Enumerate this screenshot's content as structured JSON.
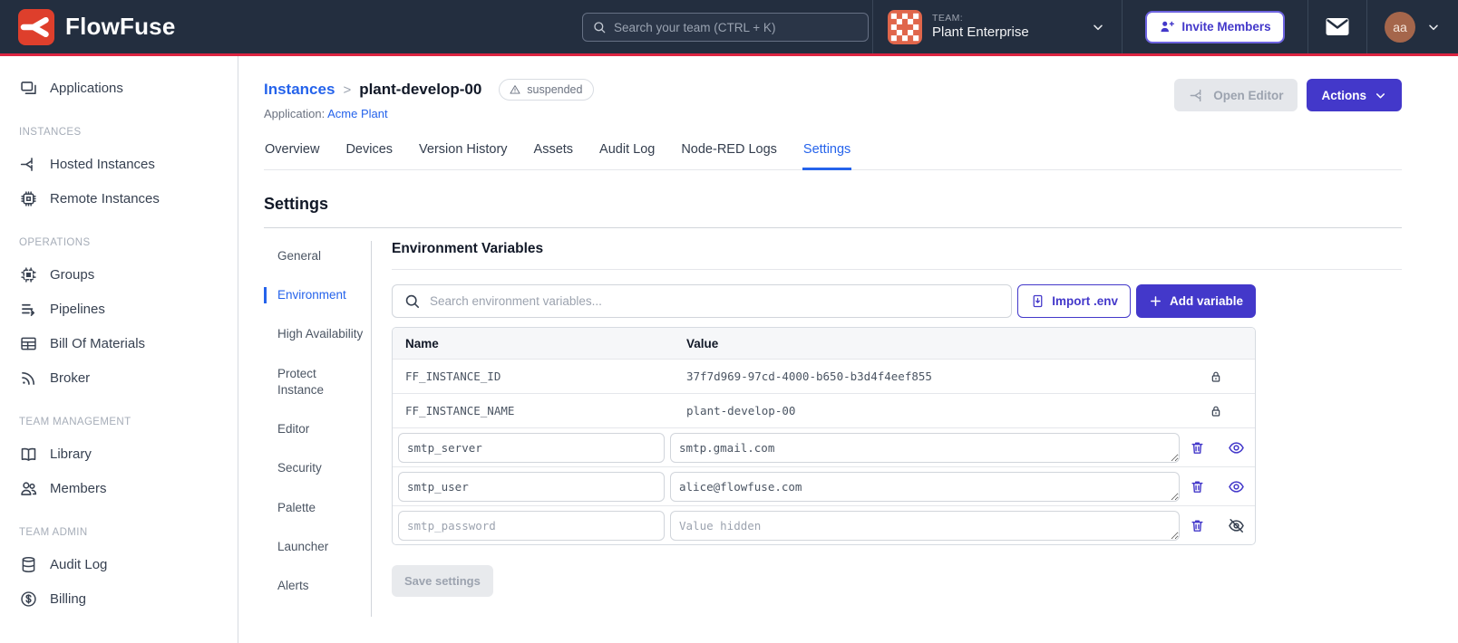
{
  "colors": {
    "navbar_bg": "#232E3F",
    "brand_red": "#DC2440",
    "accent_indigo": "#4338CA",
    "link_blue": "#2563EB",
    "team_avatar_orange": "#E0664B",
    "user_avatar_brown": "#A5664B"
  },
  "navbar": {
    "brand": "FlowFuse",
    "search_placeholder": "Search your team (CTRL + K)",
    "team_label": "TEAM:",
    "team_name": "Plant Enterprise",
    "invite_button": "Invite Members",
    "user_initials": "aa"
  },
  "sidebar": {
    "top_items": [
      {
        "label": "Applications",
        "icon": "applications-icon"
      }
    ],
    "sections": [
      {
        "title": "INSTANCES",
        "items": [
          {
            "label": "Hosted Instances",
            "icon": "hosted-instances-icon"
          },
          {
            "label": "Remote Instances",
            "icon": "remote-instances-icon"
          }
        ]
      },
      {
        "title": "OPERATIONS",
        "items": [
          {
            "label": "Groups",
            "icon": "groups-icon"
          },
          {
            "label": "Pipelines",
            "icon": "pipelines-icon"
          },
          {
            "label": "Bill Of Materials",
            "icon": "bill-of-materials-icon"
          },
          {
            "label": "Broker",
            "icon": "broker-icon"
          }
        ]
      },
      {
        "title": "TEAM MANAGEMENT",
        "items": [
          {
            "label": "Library",
            "icon": "library-icon"
          },
          {
            "label": "Members",
            "icon": "members-icon"
          }
        ]
      },
      {
        "title": "TEAM ADMIN",
        "items": [
          {
            "label": "Audit Log",
            "icon": "audit-log-icon"
          },
          {
            "label": "Billing",
            "icon": "billing-icon"
          }
        ]
      }
    ]
  },
  "header": {
    "breadcrumb_root": "Instances",
    "separator": ">",
    "instance_name": "plant-develop-00",
    "status_badge": "suspended",
    "application_label": "Application:",
    "application_name": "Acme Plant",
    "open_editor_button": "Open Editor",
    "actions_button": "Actions"
  },
  "tabs": [
    {
      "label": "Overview"
    },
    {
      "label": "Devices"
    },
    {
      "label": "Version History"
    },
    {
      "label": "Assets"
    },
    {
      "label": "Audit Log"
    },
    {
      "label": "Node-RED Logs"
    },
    {
      "label": "Settings",
      "active": true
    }
  ],
  "settings": {
    "title": "Settings",
    "nav": [
      {
        "label": "General"
      },
      {
        "label": "Environment",
        "active": true
      },
      {
        "label": "High Availability"
      },
      {
        "label": "Protect Instance"
      },
      {
        "label": "Editor"
      },
      {
        "label": "Security"
      },
      {
        "label": "Palette"
      },
      {
        "label": "Launcher"
      },
      {
        "label": "Alerts"
      }
    ],
    "environment": {
      "title": "Environment Variables",
      "search_placeholder": "Search environment variables...",
      "import_button": "Import .env",
      "add_button": "Add variable",
      "columns": [
        "Name",
        "Value"
      ],
      "locked_rows": [
        {
          "name": "FF_INSTANCE_ID",
          "value": "37f7d969-97cd-4000-b650-b3d4f4eef855"
        },
        {
          "name": "FF_INSTANCE_NAME",
          "value": "plant-develop-00"
        }
      ],
      "editable_rows": [
        {
          "name": "smtp_server",
          "value": "smtp.gmail.com",
          "hidden": false
        },
        {
          "name": "smtp_user",
          "value": "alice@flowfuse.com",
          "hidden": false
        },
        {
          "name": "smtp_password",
          "value": "",
          "value_placeholder": "Value hidden",
          "hidden": true
        }
      ],
      "save_button": "Save settings"
    }
  }
}
